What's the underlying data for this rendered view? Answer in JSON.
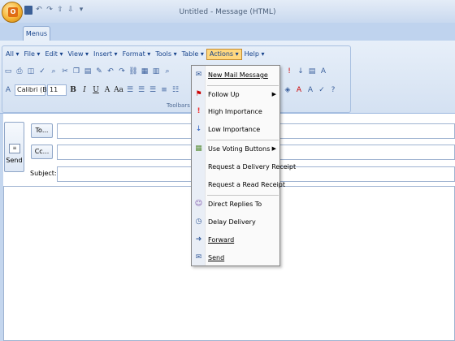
{
  "window": {
    "title": "Untitled - Message (HTML)"
  },
  "ribbon": {
    "tab": "Menus",
    "menubar": [
      "All",
      "File",
      "Edit",
      "View",
      "Insert",
      "Format",
      "Tools",
      "Table",
      "Actions",
      "Help"
    ],
    "active_menu": "Actions",
    "font_name": "Calibri (B",
    "font_size": "11",
    "group_caption": "Toolbars"
  },
  "compose": {
    "send_label": "Send",
    "to_label": "To...",
    "cc_label": "Cc...",
    "subject_label": "Subject:"
  },
  "actions_menu": {
    "items": [
      {
        "label": "New Mail Message",
        "icon": "new-mail-icon",
        "submenu": false
      },
      {
        "label": "Follow Up",
        "icon": "flag-icon",
        "submenu": true
      },
      {
        "label": "High Importance",
        "icon": "high-importance-icon",
        "submenu": false
      },
      {
        "label": "Low Importance",
        "icon": "low-importance-icon",
        "submenu": false
      },
      {
        "label": "Use Voting Buttons",
        "icon": "voting-icon",
        "submenu": true
      },
      {
        "label": "Request a Delivery Receipt",
        "icon": "",
        "submenu": false
      },
      {
        "label": "Request a Read Receipt",
        "icon": "",
        "submenu": false
      },
      {
        "label": "Direct Replies To",
        "icon": "direct-replies-icon",
        "submenu": false
      },
      {
        "label": "Delay Delivery",
        "icon": "delay-delivery-icon",
        "submenu": false
      },
      {
        "label": "Forward",
        "icon": "forward-icon",
        "submenu": false
      },
      {
        "label": "Send",
        "icon": "send-icon",
        "submenu": false
      }
    ]
  }
}
